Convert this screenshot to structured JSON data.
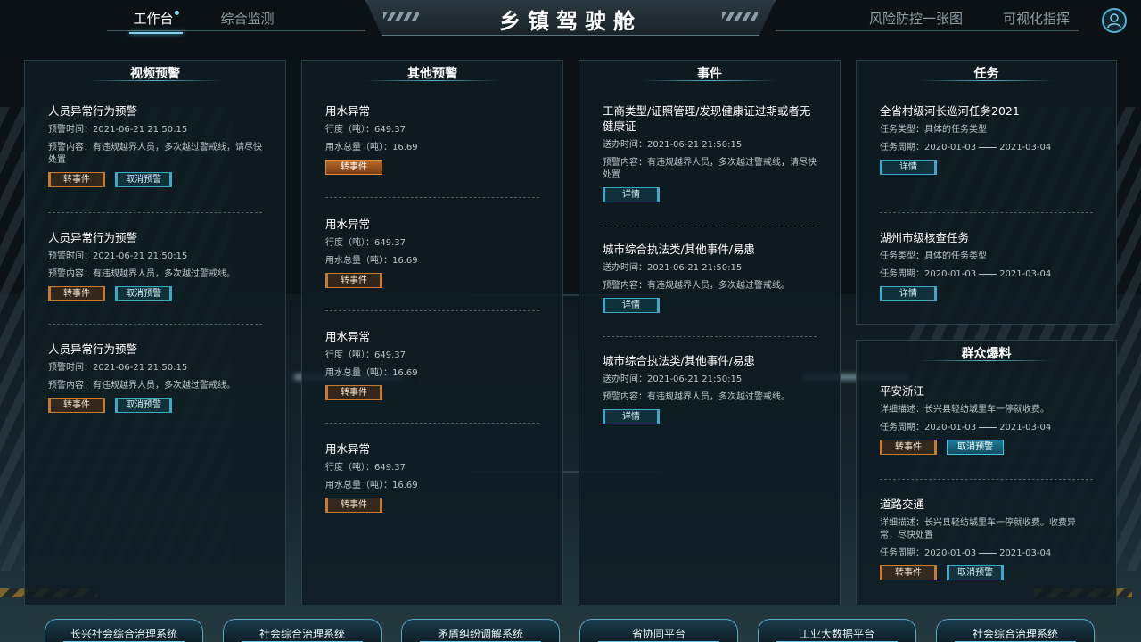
{
  "header": {
    "title": "乡镇驾驶舱",
    "nav_left": [
      {
        "label": "工作台",
        "active": true
      },
      {
        "label": "综合监测",
        "active": false
      }
    ],
    "nav_right": [
      {
        "label": "风险防控一张图",
        "active": false
      },
      {
        "label": "可视化指挥",
        "active": false
      }
    ]
  },
  "video_warning": {
    "title": "视频预警",
    "items": [
      {
        "title": "人员异常行为预警",
        "time": "预警时间：2021-06-21 21:50:15",
        "content": "预警内容：有违规越界人员，多次越过警戒线，请尽快处置",
        "btn1": "转事件",
        "btn2": "取消预警"
      },
      {
        "title": "人员异常行为预警",
        "time": "预警时间：2021-06-21 21:50:15",
        "content": "预警内容：有违规越界人员，多次越过警戒线。",
        "btn1": "转事件",
        "btn2": "取消预警"
      },
      {
        "title": "人员异常行为预警",
        "time": "预警时间：2021-06-21 21:50:15",
        "content": "预警内容：有违规越界人员，多次越过警戒线。",
        "btn1": "转事件",
        "btn2": "取消预警"
      }
    ]
  },
  "other_warning": {
    "title": "其他预警",
    "items": [
      {
        "title": "用水异常",
        "line1": "行度（吨）：649.37",
        "line2": "用水总量（吨）：16.69",
        "btn": "转事件"
      },
      {
        "title": "用水异常",
        "line1": "行度（吨）：649.37",
        "line2": "用水总量（吨）：16.69",
        "btn": "转事件"
      },
      {
        "title": "用水异常",
        "line1": "行度（吨）：649.37",
        "line2": "用水总量（吨）：16.69",
        "btn": "转事件"
      },
      {
        "title": "用水异常",
        "line1": "行度（吨）：649.37",
        "line2": "用水总量（吨）：16.69",
        "btn": "转事件"
      }
    ]
  },
  "events": {
    "title": "事件",
    "items": [
      {
        "title": "工商类型/证照管理/发现健康证过期或者无健康证",
        "time": "送办时间：2021-06-21 21:50:15",
        "content": "预警内容：有违规越界人员，多次越过警戒线，请尽快处置",
        "btn": "详情"
      },
      {
        "title": "城市综合执法类/其他事件/易患",
        "time": "送办时间：2021-06-21 21:50:15",
        "content": "预警内容：有违规越界人员，多次越过警戒线。",
        "btn": "详情"
      },
      {
        "title": "城市综合执法类/其他事件/易患",
        "time": "送办时间：2021-06-21 21:50:15",
        "content": "预警内容：有违规越界人员，多次越过警戒线。",
        "btn": "详情"
      }
    ]
  },
  "tasks": {
    "title": "任务",
    "items": [
      {
        "title": "全省村级河长巡河任务2021",
        "type": "任务类型：具体的任务类型",
        "period_label": "任务周期：",
        "start": "2020-01-03",
        "end": "2021-03-04",
        "btn": "详情"
      },
      {
        "title": "湖州市级核查任务",
        "type": "任务类型：具体的任务类型",
        "period_label": "任务周期：",
        "start": "2020-01-03",
        "end": "2021-03-04",
        "btn": "详情"
      }
    ]
  },
  "public_reports": {
    "title": "群众爆料",
    "items": [
      {
        "title": "平安浙江",
        "desc": "详细描述：长兴县轻纺城里车一停就收费。",
        "period_label": "任务周期：",
        "start": "2020-01-03",
        "end": "2021-03-04",
        "btn1": "转事件",
        "btn2": "取消预警"
      },
      {
        "title": "道路交通",
        "desc": "详细描述：长兴县轻纺城里车一停就收费。收费异常，尽快处置",
        "period_label": "任务周期：",
        "start": "2020-01-03",
        "end": "2021-03-04",
        "btn1": "转事件",
        "btn2": "取消预警"
      }
    ]
  },
  "bottom_nav": [
    "长兴社会综合治理系统",
    "社会综合治理系统",
    "矛盾纠纷调解系统",
    "省协同平台",
    "工业大数据平台",
    "社会综合治理系统"
  ]
}
